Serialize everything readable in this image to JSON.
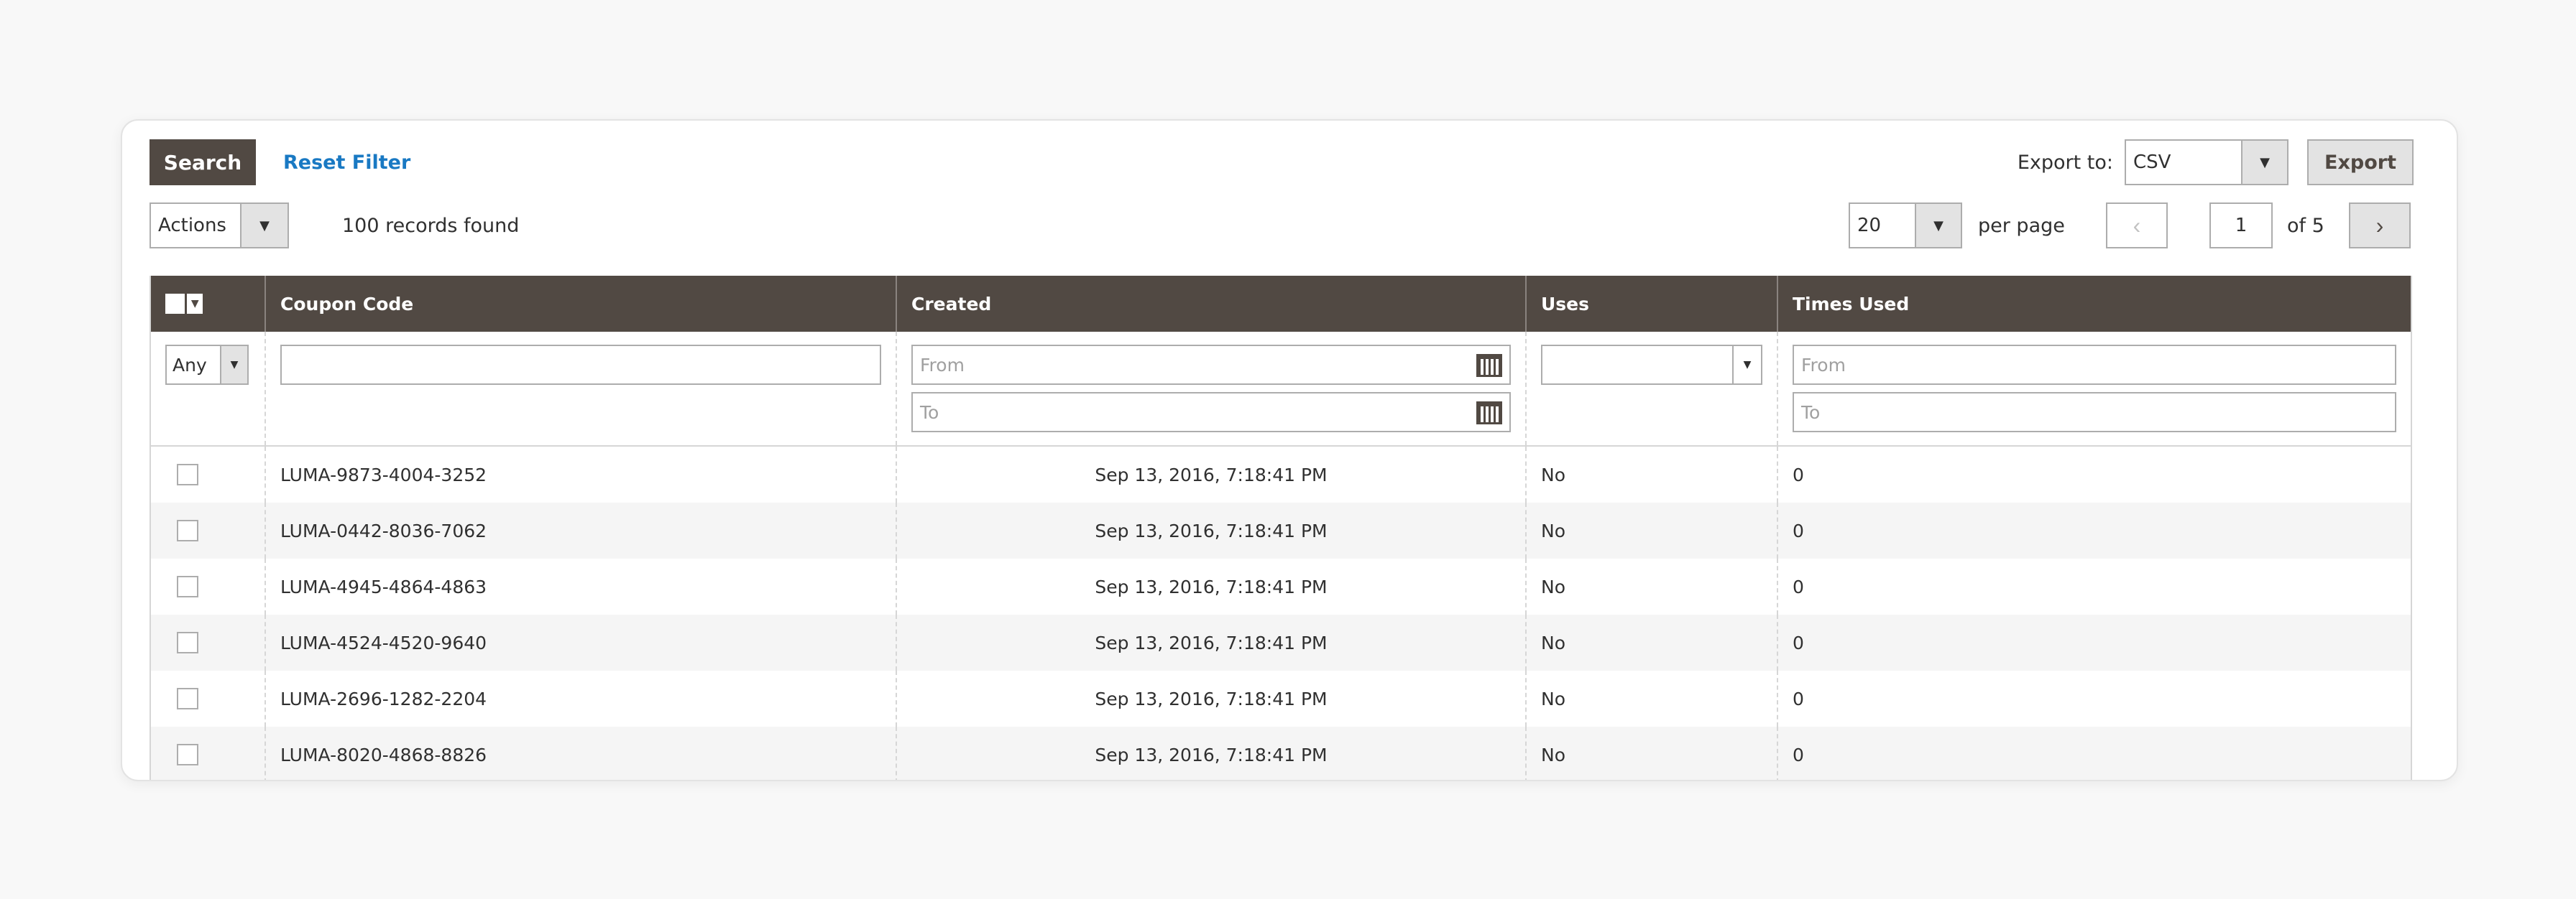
{
  "toolbar": {
    "search_label": "Search",
    "reset_label": "Reset Filter",
    "export_to_label": "Export to:",
    "export_format": "CSV",
    "export_label": "Export",
    "actions_label": "Actions",
    "records_found": "100 records found",
    "per_page_value": "20",
    "per_page_label": "per page",
    "current_page": "1",
    "of_pages": "of 5"
  },
  "grid": {
    "columns": [
      "Coupon Code",
      "Created",
      "Uses",
      "Times Used"
    ],
    "filters": {
      "massaction_select": "Any",
      "created_from_placeholder": "From",
      "created_to_placeholder": "To",
      "times_used_from_placeholder": "From",
      "times_used_to_placeholder": "To"
    },
    "rows": [
      {
        "code": "LUMA-9873-4004-3252",
        "created": "Sep 13, 2016, 7:18:41 PM",
        "uses": "No",
        "times_used": "0"
      },
      {
        "code": "LUMA-0442-8036-7062",
        "created": "Sep 13, 2016, 7:18:41 PM",
        "uses": "No",
        "times_used": "0"
      },
      {
        "code": "LUMA-4945-4864-4863",
        "created": "Sep 13, 2016, 7:18:41 PM",
        "uses": "No",
        "times_used": "0"
      },
      {
        "code": "LUMA-4524-4520-9640",
        "created": "Sep 13, 2016, 7:18:41 PM",
        "uses": "No",
        "times_used": "0"
      },
      {
        "code": "LUMA-2696-1282-2204",
        "created": "Sep 13, 2016, 7:18:41 PM",
        "uses": "No",
        "times_used": "0"
      },
      {
        "code": "LUMA-8020-4868-8826",
        "created": "Sep 13, 2016, 7:18:41 PM",
        "uses": "No",
        "times_used": "0"
      }
    ]
  },
  "icons": {
    "dropdown": "chevron-down-icon",
    "prev": "chevron-left-icon",
    "next": "chevron-right-icon",
    "calendar": "calendar-icon"
  },
  "colors": {
    "header_bg": "#514943",
    "link": "#1979c3",
    "page_bg": "#f8f8f8"
  }
}
